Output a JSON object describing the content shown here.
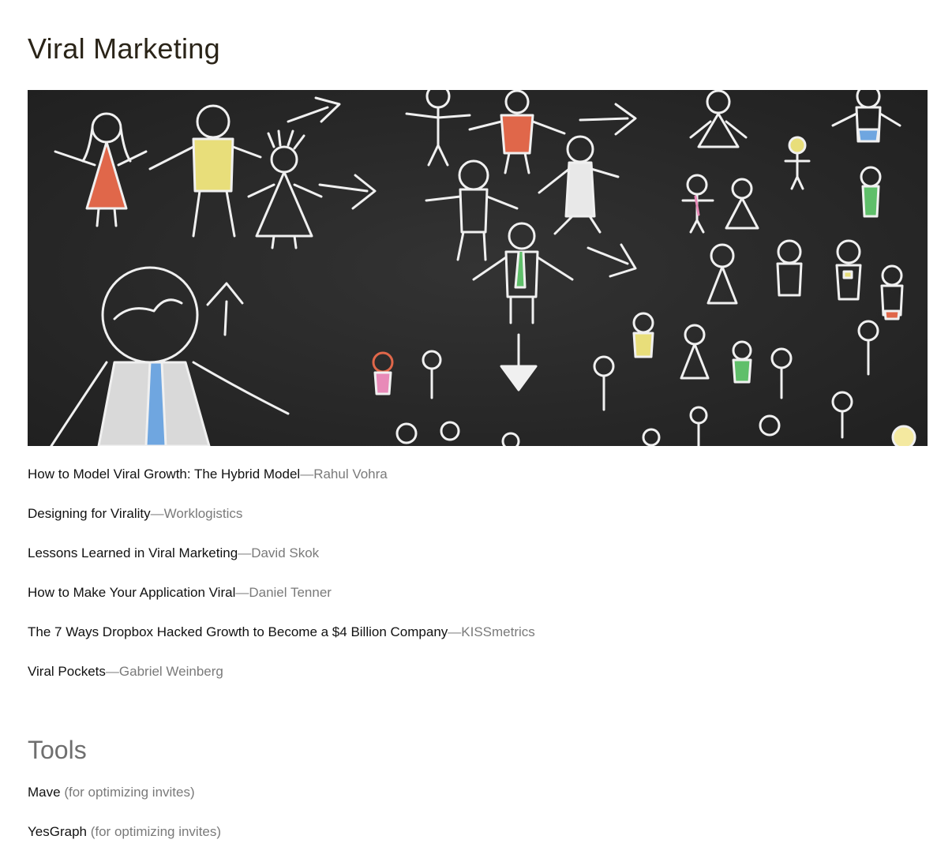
{
  "page": {
    "title": "Viral Marketing"
  },
  "hero": {
    "alt": "Chalkboard drawing of stick figures spreading with arrows",
    "background": "#2b2b2b"
  },
  "articles": [
    {
      "title": "How to Model Viral Growth: The Hybrid Model",
      "separator": "—",
      "author": "Rahul Vohra"
    },
    {
      "title": "Designing for Virality",
      "separator": "—",
      "author": "Worklogistics"
    },
    {
      "title": "Lessons Learned in Viral Marketing",
      "separator": "—",
      "author": "David Skok"
    },
    {
      "title": "How to Make Your Application Viral",
      "separator": "—",
      "author": "Daniel Tenner"
    },
    {
      "title": "The 7 Ways Dropbox Hacked Growth to Become a $4 Billion Company",
      "separator": "—",
      "author": "KISSmetrics"
    },
    {
      "title": "Viral Pockets",
      "separator": "—",
      "author": "Gabriel Weinberg"
    }
  ],
  "tools": {
    "heading": "Tools",
    "items": [
      {
        "name": "Mave",
        "note": "(for optimizing invites)"
      },
      {
        "name": "YesGraph",
        "note": "(for optimizing invites)"
      }
    ]
  },
  "colors": {
    "title": "#2a2418",
    "link": "#111111",
    "author": "#7a7a7a",
    "section_heading": "#6f6f6f",
    "chalk": "#f2f2f2",
    "chalk_red": "#e0674a",
    "chalk_yellow": "#e8de7a",
    "chalk_green": "#5fbf6a",
    "chalk_blue": "#6fa6e0"
  }
}
